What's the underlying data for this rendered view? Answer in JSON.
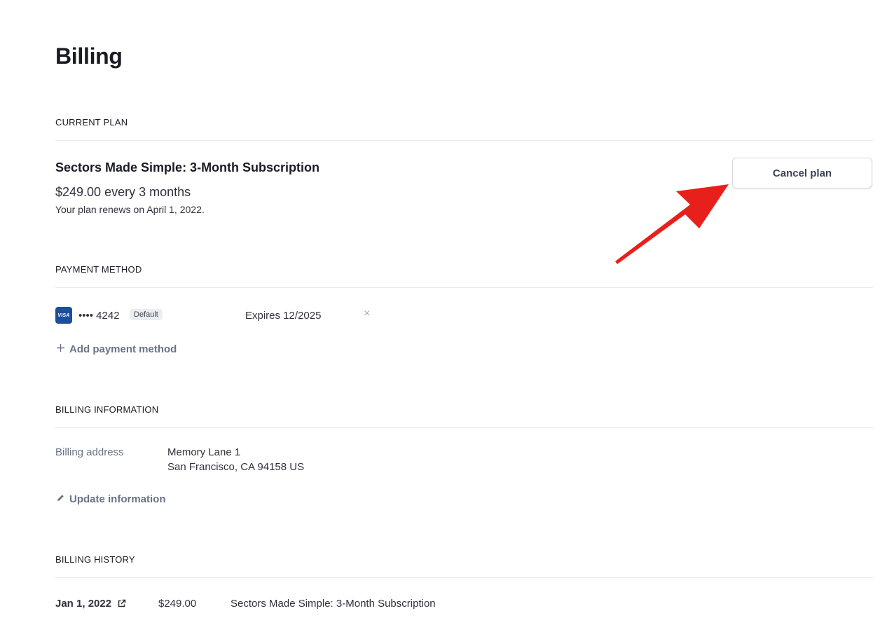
{
  "page": {
    "title": "Billing"
  },
  "current_plan": {
    "heading": "CURRENT PLAN",
    "plan_name": "Sectors Made Simple: 3-Month Subscription",
    "price": "$249.00 every 3 months",
    "renewal": "Your plan renews on April 1, 2022.",
    "cancel_label": "Cancel plan"
  },
  "payment_method": {
    "heading": "PAYMENT METHOD",
    "card_brand": "VISA",
    "card_number": "•••• 4242",
    "badge": "Default",
    "expires": "Expires 12/2025",
    "remove_glyph": "×",
    "add_label": "Add payment method",
    "add_icon": "plus-icon",
    "colors": {
      "visa_bg": "#1a4fa0",
      "badge_bg": "#ebeef1"
    }
  },
  "billing_info": {
    "heading": "BILLING INFORMATION",
    "label": "Billing address",
    "address_line1": "Memory Lane 1",
    "address_line2": "San Francisco, CA 94158 US",
    "update_label": "Update information",
    "update_icon": "pencil-icon"
  },
  "billing_history": {
    "heading": "BILLING HISTORY",
    "rows": [
      {
        "date": "Jan 1, 2022",
        "amount": "$249.00",
        "description": "Sectors Made Simple: 3-Month Subscription"
      }
    ]
  },
  "annotation": {
    "arrow_color": "#e8201c",
    "arrow_icon": "red-arrow-pointing-at-cancel"
  }
}
